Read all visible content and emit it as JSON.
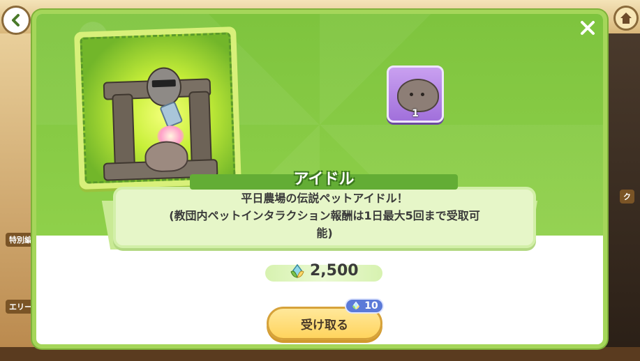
{
  "background": {
    "left_labels": [
      "特別編",
      "エリー"
    ],
    "right_label": "ク"
  },
  "nav": {
    "back_icon": "chevron-left-icon",
    "home_icon": "home-icon"
  },
  "modal": {
    "close_icon": "close-icon",
    "item_name": "アイドル",
    "description": "平日農場の伝説ペットアイドル！\n(教団内ペットインタラクション報酬は1日最大5回まで受取可能)",
    "reward_quantity": "1",
    "price": {
      "icon": "crystal-flower-icon",
      "value": "2,500"
    },
    "receive_button": {
      "label": "受け取る",
      "badge_icon": "crystal-flower-icon",
      "badge_value": "10"
    }
  },
  "colors": {
    "modal_border": "#a5d65a",
    "modal_top": "#7ec43e",
    "name_bar": "#63ad35",
    "button": "#ffd45e",
    "badge": "#5b7ad8",
    "reward_slot": "#a170db"
  }
}
